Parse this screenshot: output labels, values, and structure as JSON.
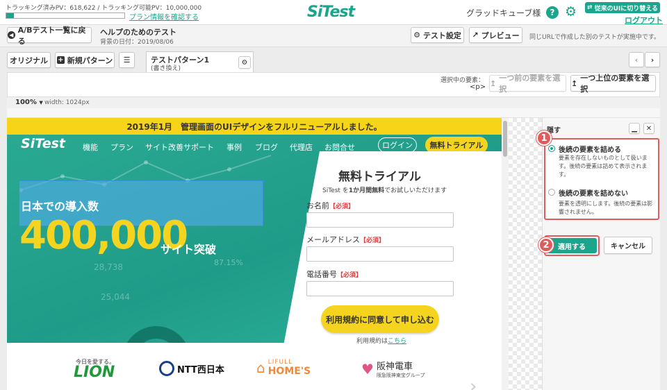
{
  "top": {
    "tracking": "トラッキング済みPV：618,622 / トラッキング可能PV：10,000,000",
    "tracking_progress": 0.062,
    "plan_link": "プラン情報を確認する",
    "logo": "SiTest",
    "user": "グラッドキューブ様",
    "switch_ui": "従来のUIに切り替える",
    "logout": "ログアウト"
  },
  "toolbar": {
    "back": "A/Bテスト一覧に戻る",
    "test_name": "ヘルプのためのテスト",
    "bg_date": "背景の日付：2019/08/06",
    "settings": "テスト設定",
    "preview": "プレビュー",
    "note": "同じURLで作成した別のテストが実施中です。"
  },
  "tabs": {
    "original": "オリジナル",
    "new_pattern": "新規パターン",
    "pattern_name": "テストパターン1",
    "pattern_sub": "(書き換え)"
  },
  "selection": {
    "label": "選択中の要素：",
    "value": "<p>",
    "prev": "一つ前の要素を選択",
    "parent": "一つ上位の要素を選択"
  },
  "zoom": {
    "level": "100%",
    "width": "width: 1024px"
  },
  "site": {
    "banner": "2019年1月　管理画面のUIデザインをフルリニューアルしました。",
    "logo": "SiTest",
    "nav": [
      "機能",
      "プラン",
      "サイト改善サポート",
      "事例",
      "ブログ",
      "代理店",
      "お問合せ"
    ],
    "login": "ログイン",
    "trial_btn": "無料トライアル",
    "hero_label": "日本での導入数",
    "hero_number": "400,000",
    "hero_suffix": "サイト突破",
    "bg_numbers": [
      "28,738",
      "25,044",
      "87.15%"
    ],
    "form": {
      "title": "無料トライアル",
      "subtitle_pre": "SiTest を",
      "subtitle_bold": "1か月間無料",
      "subtitle_post": "でお試しいただけます",
      "name": "お名前",
      "email": "メールアドレス",
      "phone": "電話番号",
      "required": "【必須】",
      "submit": "利用規約に同意して申し込む",
      "terms_pre": "利用規約は",
      "terms_link": "こちら"
    },
    "logos": {
      "lion_small": "今日を愛する。",
      "lion": "LION",
      "ntt": "NTT西日本",
      "lifull_top": "LIFULL",
      "lifull": "HOME'S",
      "hanshin": "阪神電車",
      "hanshin_sub": "阪急阪神東宝グループ"
    }
  },
  "panel": {
    "title": "隠す",
    "opt1": "後続の要素を詰める",
    "opt1_desc": "要素を存在しないものとして扱います。後続の要素は詰めて表示されます。",
    "opt2": "後続の要素を詰めない",
    "opt2_desc": "要素を透明にします。後続の要素は影響されません。",
    "apply": "適用する",
    "cancel": "キャンセル",
    "badge1": "1",
    "badge2": "2"
  },
  "colors": {
    "accent": "#1aa58c",
    "banner": "#f7d417",
    "callout": "#e05c5c",
    "hero_yellow": "#f5d420"
  }
}
